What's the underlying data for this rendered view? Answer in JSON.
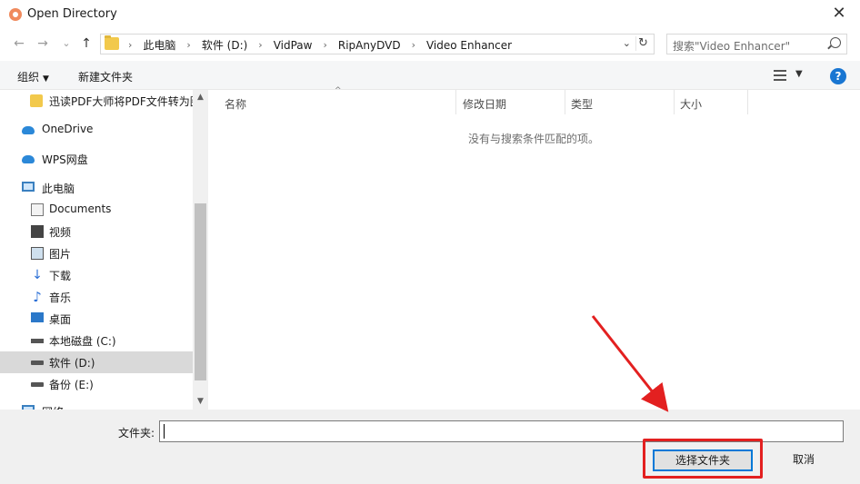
{
  "window": {
    "title": "Open Directory",
    "close_glyph": "✕"
  },
  "nav": {
    "back_glyph": "←",
    "forward_glyph": "→",
    "recent_glyph": "⌄",
    "up_glyph": "↑",
    "breadcrumbs": [
      "此电脑",
      "软件 (D:)",
      "VidPaw",
      "RipAnyDVD",
      "Video Enhancer"
    ],
    "separator": "›",
    "dropdown_glyph": "⌄",
    "refresh_glyph": "↻",
    "search_placeholder": "搜索\"Video Enhancer\""
  },
  "commands": {
    "organize": "组织",
    "organize_caret": "▼",
    "new_folder": "新建文件夹",
    "view_caret": "▼",
    "help": "?"
  },
  "sidebar": {
    "items": [
      {
        "label": "迅读PDF大师将PDF文件转为图",
        "icon": "folder-icon"
      },
      {
        "label": "OneDrive",
        "icon": "cloud-icon"
      },
      {
        "label": "WPS网盘",
        "icon": "wps-cloud-icon"
      },
      {
        "label": "此电脑",
        "icon": "computer-icon"
      },
      {
        "label": "Documents",
        "icon": "document-icon"
      },
      {
        "label": "视频",
        "icon": "video-icon"
      },
      {
        "label": "图片",
        "icon": "picture-icon"
      },
      {
        "label": "下载",
        "icon": "download-icon"
      },
      {
        "label": "音乐",
        "icon": "music-icon"
      },
      {
        "label": "桌面",
        "icon": "desktop-icon"
      },
      {
        "label": "本地磁盘 (C:)",
        "icon": "drive-icon"
      },
      {
        "label": "软件 (D:)",
        "icon": "drive-icon",
        "selected": true
      },
      {
        "label": "备份 (E:)",
        "icon": "drive-icon"
      },
      {
        "label": "网络",
        "icon": "network-icon"
      }
    ],
    "down_glyph": "↓",
    "music_glyph": "♪",
    "scroll_up_glyph": "▲",
    "scroll_down_glyph": "▼"
  },
  "columns": {
    "name": "名称",
    "date": "修改日期",
    "type": "类型",
    "size": "大小",
    "sort_glyph": "^"
  },
  "empty_message": "没有与搜索条件匹配的项。",
  "footer": {
    "folder_label": "文件夹:",
    "folder_value": "",
    "select_button": "选择文件夹",
    "cancel_button": "取消"
  },
  "colors": {
    "highlight_red": "#e32020",
    "accent_blue": "#0078d7"
  }
}
